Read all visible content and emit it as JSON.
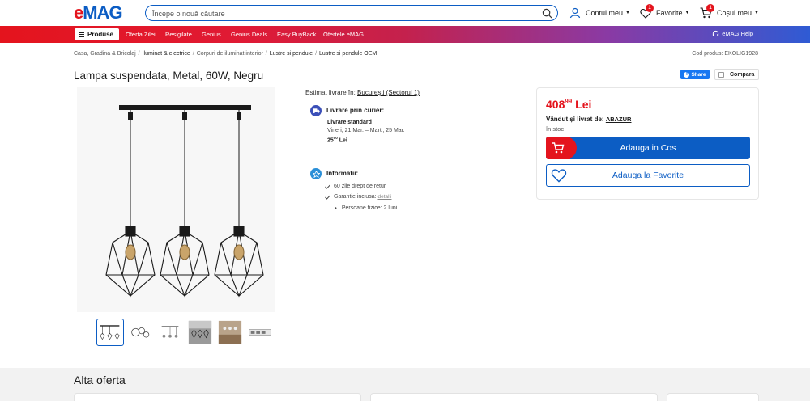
{
  "header": {
    "logo_e": "e",
    "logo_mag": "MAG",
    "search_placeholder": "Începe o nouă căutare",
    "account_label": "Contul meu",
    "favorites_label": "Favorite",
    "favorites_count": "1",
    "cart_label": "Coșul meu",
    "cart_count": "1"
  },
  "nav": {
    "products_label": "Produse",
    "links": [
      "Oferta Zilei",
      "Resigilate",
      "Genius",
      "Genius Deals",
      "Easy BuyBack",
      "Ofertele eMAG"
    ],
    "help_label": "eMAG Help"
  },
  "breadcrumb": {
    "items": [
      "Casa, Gradina & Bricolaj",
      "Iluminat & electrice",
      "Corpuri de iluminat interior",
      "Lustre si pendule",
      "Lustre si pendule OEM"
    ],
    "product_code": "Cod produs: EKOLIG1928"
  },
  "product": {
    "title": "Lampa suspendata, Metal, 60W, Negru",
    "share_label": "Share",
    "compare_label": "Compara"
  },
  "delivery": {
    "estimate_prefix": "Estimat livrare în:",
    "location": "București (Sectorul 1)",
    "courier_title": "Livrare prin curier:",
    "standard_label": "Livrare standard",
    "dates": "Vineri, 21 Mar. – Marti, 25 Mar.",
    "cost_main": "25",
    "cost_cents": "00",
    "cost_currency": "Lei"
  },
  "info": {
    "title": "Informatii:",
    "return": "60 zile drept de retur",
    "warranty": "Garantie inclusa:",
    "warranty_link": "detalii",
    "persons": "Persoane fizice: 2 luni"
  },
  "buy": {
    "price_main": "408",
    "price_cents": "99",
    "currency": "Lei",
    "sold_by_prefix": "Vândut și livrat de:",
    "seller": "ABAZUR",
    "stock": "în stoc",
    "add_to_cart": "Adauga in Cos",
    "add_to_favorites": "Adauga la Favorite"
  },
  "other_offers": {
    "title": "Alta oferta"
  },
  "colors": {
    "brand_red": "#e4141d",
    "brand_blue": "#0c5dc4"
  }
}
